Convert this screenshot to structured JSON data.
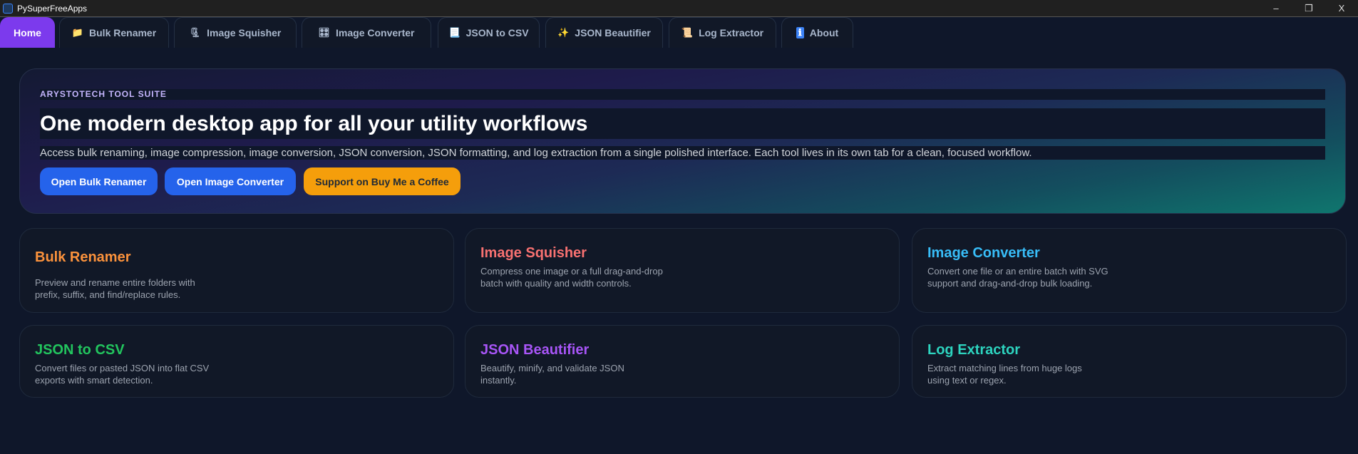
{
  "window": {
    "title": "PySuperFreeApps",
    "minimize": "–",
    "maximize": "❐",
    "close": "X"
  },
  "tabs": [
    {
      "label": "Home",
      "icon": ""
    },
    {
      "label": "Bulk Renamer",
      "icon": "📁"
    },
    {
      "label": "Image Squisher",
      "icon": "🗜"
    },
    {
      "label": "Image Converter",
      "icon": "🎛"
    },
    {
      "label": "JSON to CSV",
      "icon": "📃"
    },
    {
      "label": "JSON Beautifier",
      "icon": "✨"
    },
    {
      "label": "Log Extractor",
      "icon": "📜"
    },
    {
      "label": "About",
      "icon": "ℹ"
    }
  ],
  "hero": {
    "eyebrow": "ARYSTOTECH TOOL SUITE",
    "title": "One modern desktop app for all your utility workflows",
    "description": "Access bulk renaming, image compression, image conversion, JSON conversion, JSON formatting, and log extraction from a single polished interface. Each tool lives in its own tab for a clean, focused workflow.",
    "buttons": [
      "Open Bulk Renamer",
      "Open Image Converter",
      "Support on Buy Me a Coffee"
    ]
  },
  "cards": [
    {
      "title": "Bulk Renamer",
      "desc": "Preview and rename entire folders with prefix, suffix, and find/replace rules.",
      "color": "#fb923c"
    },
    {
      "title": "Image Squisher",
      "desc": "Compress one image or a full drag-and-drop batch with quality and width controls.",
      "color": "#f87171"
    },
    {
      "title": "Image Converter",
      "desc": "Convert one file or an entire batch with SVG support and drag-and-drop bulk loading.",
      "color": "#38bdf8"
    },
    {
      "title": "JSON to CSV",
      "desc": "Convert files or pasted JSON into flat CSV exports with smart detection.",
      "color": "#22c55e"
    },
    {
      "title": "JSON Beautifier",
      "desc": "Beautify, minify, and validate JSON instantly.",
      "color": "#a855f7"
    },
    {
      "title": "Log Extractor",
      "desc": "Extract matching lines from huge logs using text or regex.",
      "color": "#2dd4bf"
    }
  ]
}
